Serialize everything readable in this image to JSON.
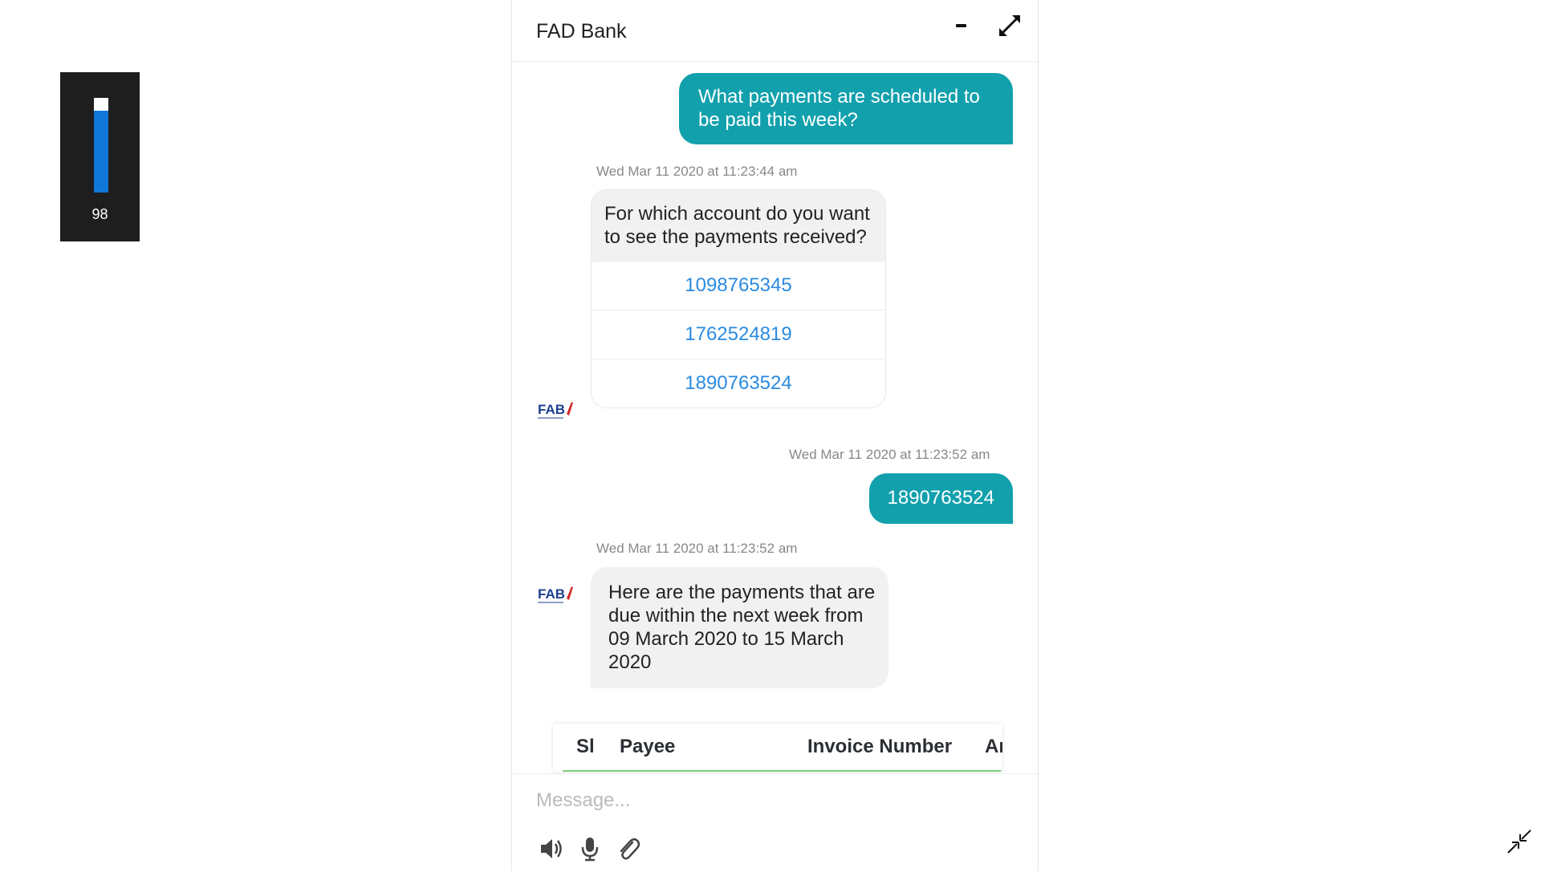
{
  "volume": {
    "value": "98",
    "level": 0.98
  },
  "chat": {
    "title": "FAD Bank",
    "messages": {
      "user1": "What payments are scheduled to be paid this week?",
      "ts1": "Wed Mar 11 2020 at 11:23:44 am",
      "bot1": "For which account do you want to see the payments received?",
      "options": [
        "1098765345",
        "1762524819",
        "1890763524"
      ],
      "ts2": "Wed Mar 11 2020 at 11:23:52 am",
      "user2": "1890763524",
      "ts3": "Wed Mar 11 2020 at 11:23:52 am",
      "bot2": "Here are the payments that are due within the next week from 09 March 2020 to 15 March 2020"
    },
    "table": {
      "headers": [
        "Sl",
        "Payee",
        "Invoice Number",
        "Am"
      ]
    },
    "composer": {
      "placeholder": "Message..."
    },
    "avatar": {
      "text": "FAB"
    }
  },
  "colors": {
    "user_bubble": "#12a0ad",
    "bot_bubble": "#f1f1f1",
    "link": "#2a8be0",
    "volume_fill": "#1177d9"
  },
  "icons": [
    "minimize-icon",
    "expand-icon",
    "speaker-icon",
    "microphone-icon",
    "paperclip-icon",
    "collapse-icon"
  ]
}
